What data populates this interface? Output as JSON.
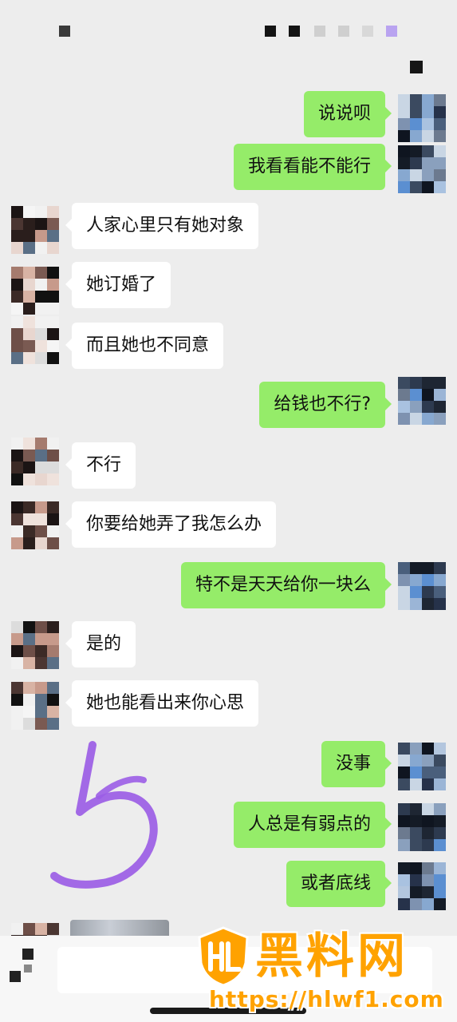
{
  "colors": {
    "background": "#ededed",
    "bubble_outgoing": "#95ec69",
    "bubble_incoming": "#ffffff",
    "watermark": "#ffa200",
    "scribble": "#9b5de5"
  },
  "messages": [
    {
      "side": "out",
      "text": "说说呗"
    },
    {
      "side": "out",
      "text": "我看看能不能行"
    },
    {
      "side": "in",
      "text": "人家心里只有她对象"
    },
    {
      "side": "in",
      "text": "她订婚了"
    },
    {
      "side": "in",
      "text": "而且她也不同意"
    },
    {
      "side": "out",
      "text": "给钱也不行?"
    },
    {
      "side": "in",
      "text": "不行"
    },
    {
      "side": "in",
      "text": "你要给她弄了我怎么办"
    },
    {
      "side": "out",
      "text": "特不是天天给你一块么"
    },
    {
      "side": "in",
      "text": "是的"
    },
    {
      "side": "in",
      "text": "她也能看出来你心思"
    },
    {
      "side": "out",
      "text": "没事"
    },
    {
      "side": "out",
      "text": "人总是有弱点的"
    },
    {
      "side": "out",
      "text": "或者底线"
    }
  ],
  "annotation": {
    "text": "5"
  },
  "watermark": {
    "title": "黑料网",
    "url": "https://hlwf1.com"
  },
  "icons": {
    "avatar": "pixelated-avatar-icon",
    "logo": "hl-shield-logo-icon"
  }
}
